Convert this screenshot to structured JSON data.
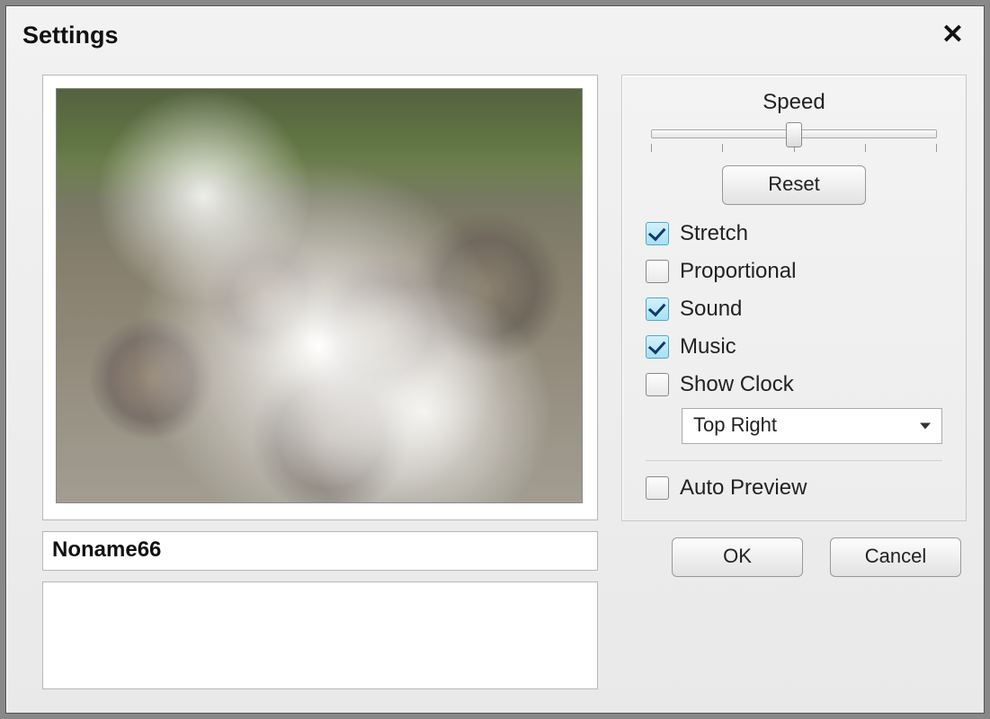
{
  "window": {
    "title": "Settings"
  },
  "preview": {
    "name": "Noname66",
    "description": ""
  },
  "controls": {
    "speed_label": "Speed",
    "speed_value_percent": 50,
    "reset_label": "Reset",
    "checkboxes": {
      "stretch": {
        "label": "Stretch",
        "checked": true
      },
      "proportional": {
        "label": "Proportional",
        "checked": false
      },
      "sound": {
        "label": "Sound",
        "checked": true
      },
      "music": {
        "label": "Music",
        "checked": true
      },
      "show_clock": {
        "label": "Show Clock",
        "checked": false
      }
    },
    "clock_position": "Top Right",
    "auto_preview": {
      "label": "Auto Preview",
      "checked": false
    }
  },
  "buttons": {
    "ok": "OK",
    "cancel": "Cancel"
  }
}
